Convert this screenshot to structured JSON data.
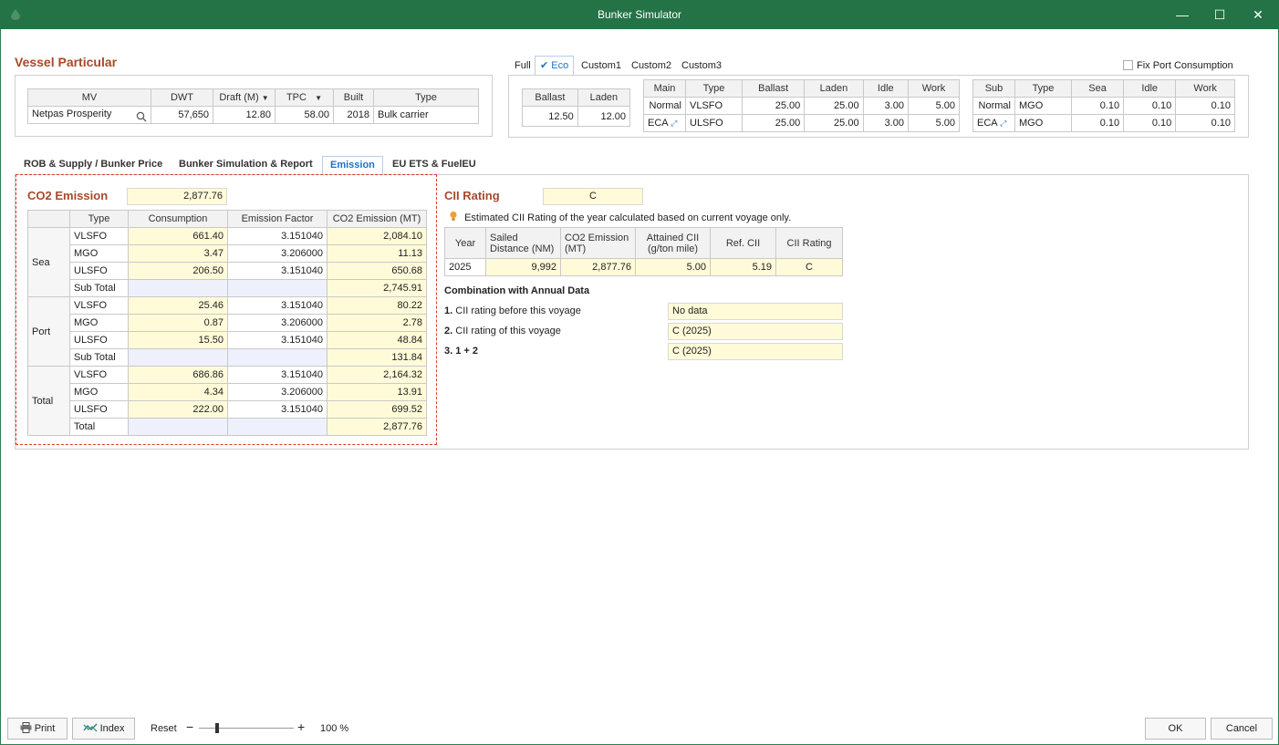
{
  "window": {
    "title": "Bunker Simulator"
  },
  "vessel": {
    "heading": "Vessel Particular",
    "headers": [
      "MV",
      "DWT",
      "Draft (M)",
      "TPC",
      "Built",
      "Type"
    ],
    "row": {
      "mv": "Netpas Prosperity",
      "dwt": "57,650",
      "draft": "12.80",
      "tpc": "58.00",
      "built": "2018",
      "type": "Bulk carrier"
    }
  },
  "speed_modes": {
    "items": [
      "Full",
      "Eco",
      "Custom1",
      "Custom2",
      "Custom3"
    ],
    "selected": "Eco"
  },
  "fix_port": {
    "label": "Fix Port Consumption",
    "checked": false
  },
  "speed_table": {
    "headers": [
      "Ballast",
      "Laden"
    ],
    "values": [
      "12.50",
      "12.00"
    ]
  },
  "main_table": {
    "headers": [
      "Main",
      "Type",
      "Ballast",
      "Laden",
      "Idle",
      "Work"
    ],
    "rows": [
      [
        "Normal",
        "VLSFO",
        "25.00",
        "25.00",
        "3.00",
        "5.00"
      ],
      [
        "ECA",
        "ULSFO",
        "25.00",
        "25.00",
        "3.00",
        "5.00"
      ]
    ]
  },
  "sub_table": {
    "headers": [
      "Sub",
      "Type",
      "Sea",
      "Idle",
      "Work"
    ],
    "rows": [
      [
        "Normal",
        "MGO",
        "0.10",
        "0.10",
        "0.10"
      ],
      [
        "ECA",
        "MGO",
        "0.10",
        "0.10",
        "0.10"
      ]
    ]
  },
  "tabs": [
    "ROB & Supply / Bunker Price",
    "Bunker Simulation & Report",
    "Emission",
    "EU ETS & FuelEU"
  ],
  "active_tab": "Emission",
  "co2": {
    "heading": "CO2 Emission",
    "total": "2,877.76",
    "headers": [
      "Type",
      "Consumption",
      "Emission Factor",
      "CO2 Emission (MT)"
    ],
    "groups": [
      {
        "name": "Sea",
        "rows": [
          [
            "VLSFO",
            "661.40",
            "3.151040",
            "2,084.10"
          ],
          [
            "MGO",
            "3.47",
            "3.206000",
            "11.13"
          ],
          [
            "ULSFO",
            "206.50",
            "3.151040",
            "650.68"
          ]
        ],
        "subtotal_label": "Sub Total",
        "subtotal": "2,745.91"
      },
      {
        "name": "Port",
        "rows": [
          [
            "VLSFO",
            "25.46",
            "3.151040",
            "80.22"
          ],
          [
            "MGO",
            "0.87",
            "3.206000",
            "2.78"
          ],
          [
            "ULSFO",
            "15.50",
            "3.151040",
            "48.84"
          ]
        ],
        "subtotal_label": "Sub Total",
        "subtotal": "131.84"
      },
      {
        "name": "Total",
        "rows": [
          [
            "VLSFO",
            "686.86",
            "3.151040",
            "2,164.32"
          ],
          [
            "MGO",
            "4.34",
            "3.206000",
            "13.91"
          ],
          [
            "ULSFO",
            "222.00",
            "3.151040",
            "699.52"
          ]
        ],
        "subtotal_label": "Total",
        "subtotal": "2,877.76"
      }
    ]
  },
  "cii": {
    "heading": "CII Rating",
    "rating": "C",
    "note": "Estimated CII Rating of the year calculated based on current voyage only.",
    "headers": [
      "Year",
      "Sailed Distance (NM)",
      "CO2 Emission (MT)",
      "Attained CII (g/ton mile)",
      "Ref. CII",
      "CII Rating"
    ],
    "row": [
      "2025",
      "9,992",
      "2,877.76",
      "5.00",
      "5.19",
      "C"
    ],
    "combo_heading": "Combination with Annual Data",
    "combo": [
      {
        "num": "1.",
        "label": "CII rating before this voyage",
        "value": "No data"
      },
      {
        "num": "2.",
        "label": "CII rating of this voyage",
        "value": "C (2025)"
      },
      {
        "num": "3.",
        "label": "1 + 2",
        "value": "C (2025)"
      }
    ]
  },
  "footer": {
    "print": "Print",
    "index": "Index",
    "reset": "Reset",
    "zoom": "100 %",
    "zoom_level": 0.5,
    "ok": "OK",
    "cancel": "Cancel"
  }
}
